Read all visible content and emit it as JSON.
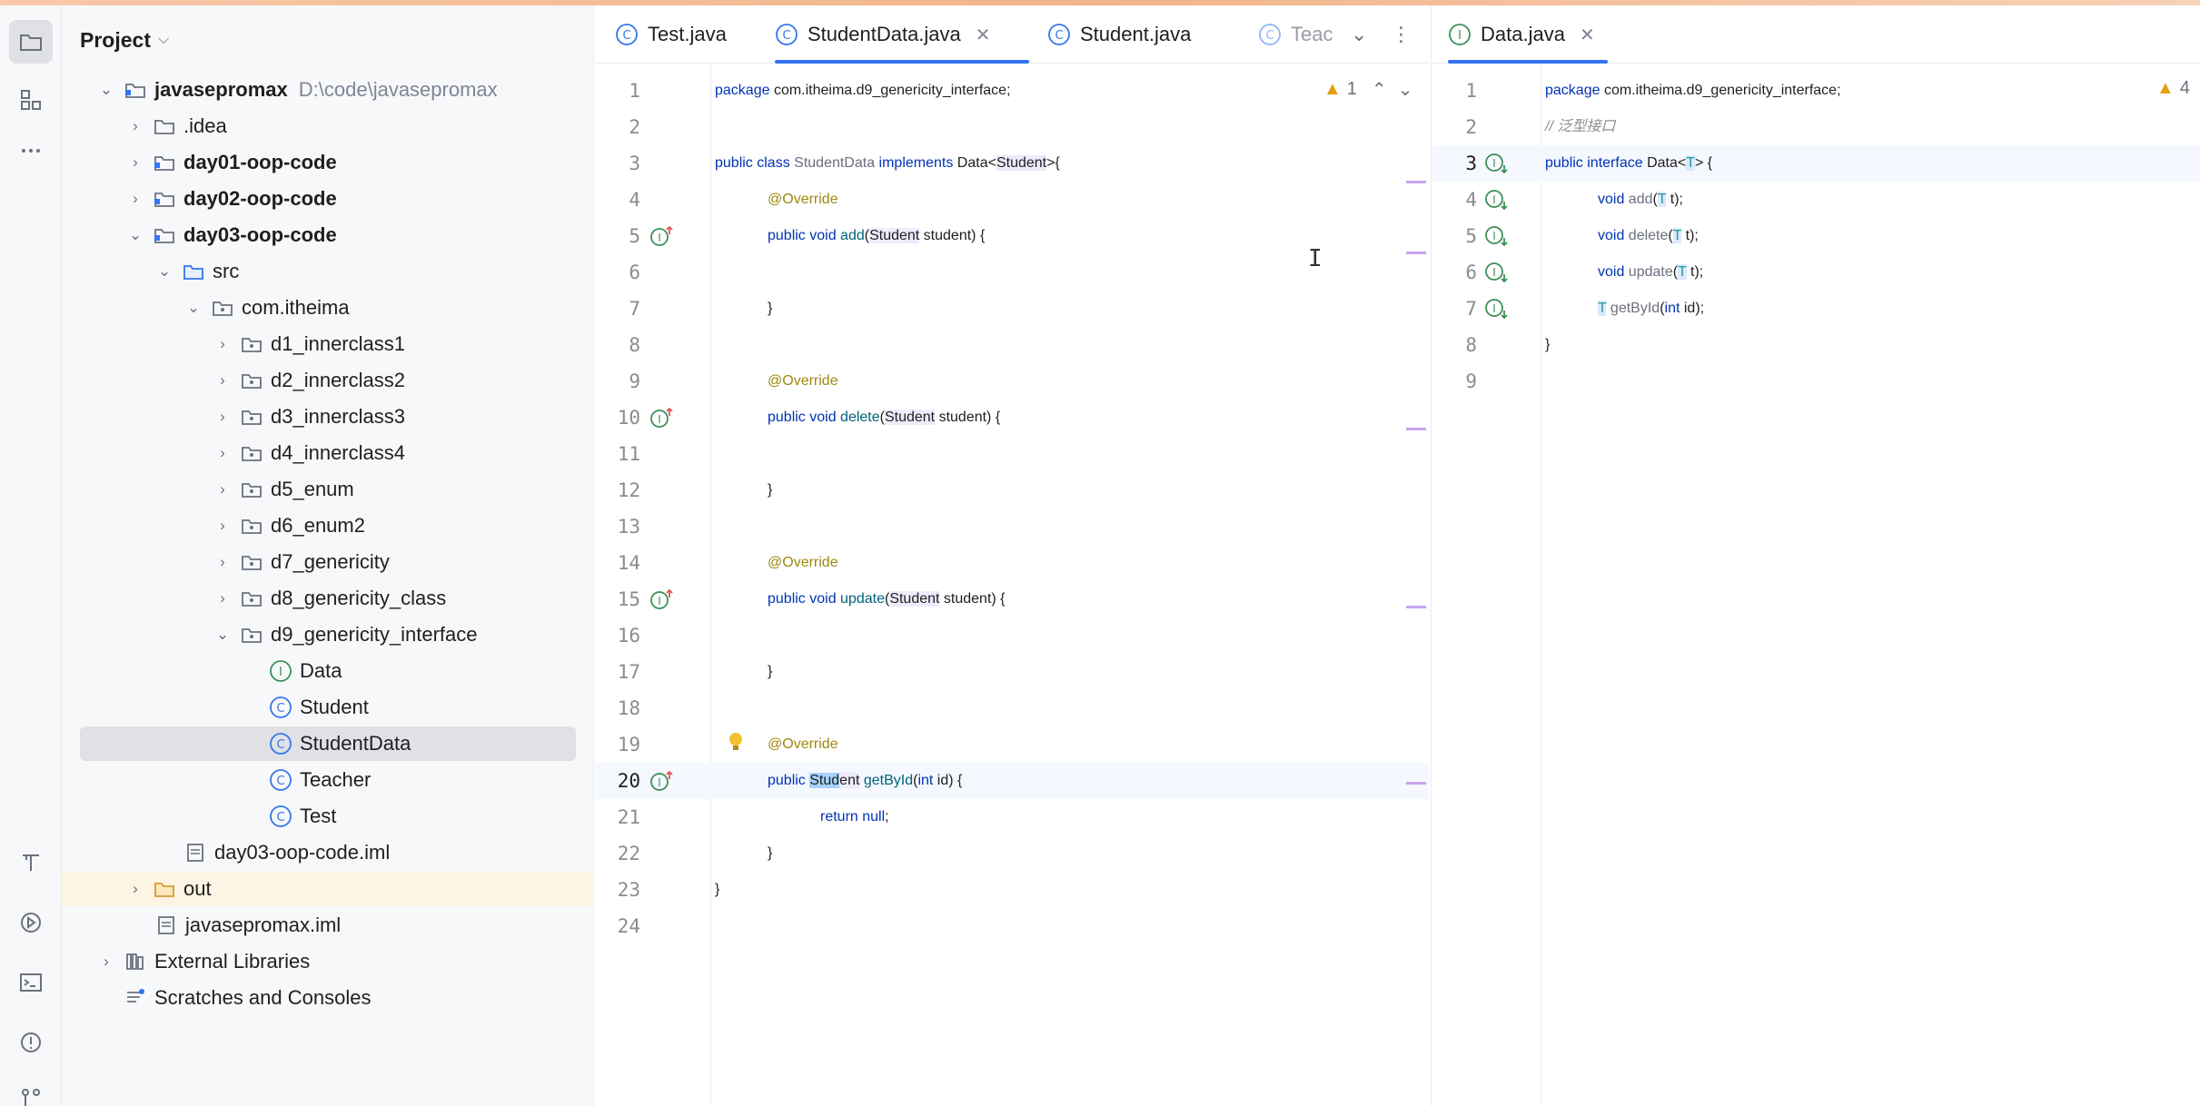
{
  "project_panel": {
    "title": "Project",
    "tree": [
      {
        "label": "javasepromax",
        "path": "D:\\code\\javasepromax"
      },
      {
        "label": ".idea"
      },
      {
        "label": "day01-oop-code"
      },
      {
        "label": "day02-oop-code"
      },
      {
        "label": "day03-oop-code"
      },
      {
        "label": "src"
      },
      {
        "label": "com.itheima"
      },
      {
        "label": "d1_innerclass1"
      },
      {
        "label": "d2_innerclass2"
      },
      {
        "label": "d3_innerclass3"
      },
      {
        "label": "d4_innerclass4"
      },
      {
        "label": "d5_enum"
      },
      {
        "label": "d6_enum2"
      },
      {
        "label": "d7_genericity"
      },
      {
        "label": "d8_genericity_class"
      },
      {
        "label": "d9_genericity_interface"
      },
      {
        "label": "Data"
      },
      {
        "label": "Student"
      },
      {
        "label": "StudentData"
      },
      {
        "label": "Teacher"
      },
      {
        "label": "Test"
      },
      {
        "label": "day03-oop-code.iml"
      },
      {
        "label": "out"
      },
      {
        "label": "javasepromax.iml"
      },
      {
        "label": "External Libraries"
      },
      {
        "label": "Scratches and Consoles"
      }
    ]
  },
  "editor_left": {
    "tabs": [
      "Test.java",
      "StudentData.java",
      "Student.java",
      "Teac"
    ],
    "active_tab": "StudentData.java",
    "warning_count": "1",
    "line_numbers": [
      "1",
      "2",
      "3",
      "4",
      "5",
      "6",
      "7",
      "8",
      "9",
      "10",
      "11",
      "12",
      "13",
      "14",
      "15",
      "16",
      "17",
      "18",
      "19",
      "20",
      "21",
      "22",
      "23",
      "24"
    ],
    "code": {
      "l1_kw": "package",
      "l1_rest": " com.itheima.d9_genericity_interface;",
      "l3_kw1": "public class",
      "l3_cls": " StudentData ",
      "l3_kw2": "implements",
      "l3_rest1": " Data<",
      "l3_type": "Student",
      "l3_rest2": ">{",
      "override": "@Override",
      "kw_public_void": "public void ",
      "m_add": "add",
      "m_delete": "delete",
      "m_update": "update",
      "paren_open": "(",
      "type_student": "Student",
      "param_rest": " student) {",
      "brace_close": "}",
      "l20_kw": "public ",
      "l20_sel": "Stud",
      "l20_type_rest": "ent",
      "l20_fn": " getById",
      "l20_paren": "(",
      "l20_int": "int",
      "l20_rest": " id) {",
      "l21_kw": "return null",
      "l21_semi": ";"
    }
  },
  "editor_right": {
    "tabs": [
      "Data.java"
    ],
    "active_tab": "Data.java",
    "warning_count": "4",
    "line_numbers": [
      "1",
      "2",
      "3",
      "4",
      "5",
      "6",
      "7",
      "8",
      "9"
    ],
    "code": {
      "l1_kw": "package",
      "l1_rest": " com.itheima.d9_genericity_interface;",
      "l2_comment": "// 泛型接口",
      "l3_kw": "public interface",
      "l3_cls": " Data<",
      "l3_t": "T",
      "l3_rest": "> {",
      "void_kw": "void ",
      "m_add": "add",
      "m_delete": "delete",
      "m_update": "update",
      "paren": "(",
      "t_type": "T",
      "t_rest": " t);",
      "l7_t": "T",
      "l7_fn": " getById",
      "l7_paren": "(",
      "l7_int": "int",
      "l7_rest": " id);",
      "brace_close": "}"
    }
  },
  "colors": {
    "accent": "#3574f0",
    "keyword": "#0033b3",
    "annotation": "#9e880d",
    "method": "#00627a",
    "interface_icon": "#3d8f58",
    "class_icon": "#3574f0"
  }
}
